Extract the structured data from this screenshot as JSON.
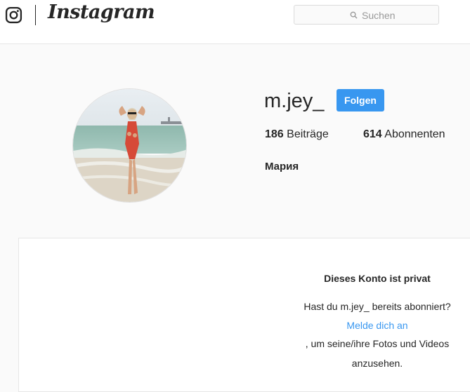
{
  "header": {
    "logo_text": "Instagram",
    "search": {
      "placeholder": "Suchen"
    }
  },
  "profile": {
    "username": "m.jey_",
    "follow_label": "Folgen",
    "posts_count": "186",
    "posts_label": "Beiträge",
    "followers_count": "614",
    "followers_label": "Abonnenten",
    "full_name": "Мария"
  },
  "private_notice": {
    "title": "Dieses Konto ist privat",
    "question": "Hast du m.jey_ bereits abonniert?",
    "login_link": "Melde dich an",
    "suffix_line1": ", um seine/ihre Fotos und Videos",
    "suffix_line2": "anzusehen."
  },
  "colors": {
    "accent": "#3897f0",
    "text": "#262626",
    "background": "#fafafa"
  },
  "icons": [
    "instagram-glyph-icon",
    "search-icon"
  ]
}
